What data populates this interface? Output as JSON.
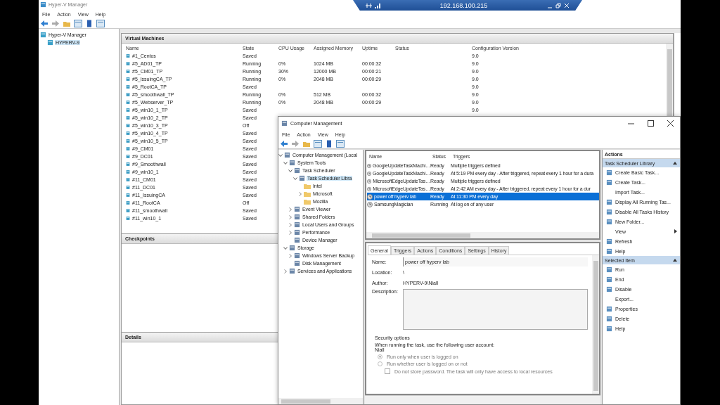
{
  "remote_bar": {
    "title": "192.168.100.215"
  },
  "hyperv": {
    "title": "Hyper-V Manager",
    "menu": [
      "File",
      "Action",
      "View",
      "Help"
    ],
    "tree": [
      {
        "label": "Hyper-V Manager",
        "selected": false
      },
      {
        "label": "HYPERV-9",
        "selected": true
      }
    ],
    "vm_panel": {
      "title": "Virtual Machines",
      "columns": [
        "Name",
        "State",
        "CPU Usage",
        "Assigned Memory",
        "Uptime",
        "Status",
        "Configuration Version"
      ],
      "rows": [
        [
          "#1_Centos",
          "Saved",
          "",
          "",
          "",
          "",
          "9.0"
        ],
        [
          "#5_AD01_TP",
          "Running",
          "0%",
          "1024 MB",
          "00:00:32",
          "",
          "9.0"
        ],
        [
          "#5_CM01_TP",
          "Running",
          "30%",
          "12000 MB",
          "00:00:21",
          "",
          "9.0"
        ],
        [
          "#5_IssuingCA_TP",
          "Running",
          "0%",
          "2048 MB",
          "00:00:29",
          "",
          "9.0"
        ],
        [
          "#5_RootCA_TP",
          "Saved",
          "",
          "",
          "",
          "",
          "9.0"
        ],
        [
          "#5_smoothwall_TP",
          "Running",
          "0%",
          "512 MB",
          "00:00:32",
          "",
          "9.0"
        ],
        [
          "#5_Webserver_TP",
          "Running",
          "0%",
          "2048 MB",
          "00:00:29",
          "",
          "9.0"
        ],
        [
          "#5_win10_1_TP",
          "Saved",
          "",
          "",
          "",
          "",
          "9.0"
        ],
        [
          "#5_win10_2_TP",
          "Saved"
        ],
        [
          "#5_win10_3_TP",
          "Off"
        ],
        [
          "#5_win10_4_TP",
          "Saved"
        ],
        [
          "#5_win10_5_TP",
          "Saved"
        ],
        [
          "#9_CM01",
          "Saved"
        ],
        [
          "#9_DC01",
          "Saved"
        ],
        [
          "#9_Smoothwall",
          "Saved"
        ],
        [
          "#9_win10_1",
          "Saved"
        ],
        [
          "#11_CM01",
          "Saved"
        ],
        [
          "#11_DC01",
          "Saved"
        ],
        [
          "#11_IssuingCA",
          "Saved"
        ],
        [
          "#11_RootCA",
          "Off"
        ],
        [
          "#11_smoothwall",
          "Saved"
        ],
        [
          "#11_win10_1",
          "Saved"
        ]
      ]
    },
    "checkpoints_title": "Checkpoints",
    "details_title": "Details"
  },
  "computer_management": {
    "title": "Computer Management",
    "menu": [
      "File",
      "Action",
      "View",
      "Help"
    ],
    "tree": [
      {
        "label": "Computer Management (Local",
        "expanded": true,
        "children": [
          {
            "label": "System Tools",
            "expanded": true,
            "children": [
              {
                "label": "Task Scheduler",
                "expanded": true,
                "children": [
                  {
                    "label": "Task Scheduler Libra",
                    "expanded": true,
                    "selected": true,
                    "children": [
                      {
                        "label": "Intel",
                        "kind": "folder"
                      },
                      {
                        "label": "Microsoft",
                        "kind": "folder",
                        "expanded": false
                      },
                      {
                        "label": "Mozilla",
                        "kind": "folder"
                      }
                    ]
                  }
                ]
              },
              {
                "label": "Event Viewer",
                "expanded": false
              },
              {
                "label": "Shared Folders",
                "expanded": false
              },
              {
                "label": "Local Users and Groups",
                "expanded": false
              },
              {
                "label": "Performance",
                "expanded": false
              },
              {
                "label": "Device Manager"
              }
            ]
          },
          {
            "label": "Storage",
            "expanded": true,
            "children": [
              {
                "label": "Windows Server Backup",
                "expanded": false
              },
              {
                "label": "Disk Management"
              }
            ]
          },
          {
            "label": "Services and Applications",
            "expanded": false
          }
        ]
      }
    ],
    "task_columns": [
      "Name",
      "Status",
      "Triggers"
    ],
    "tasks": [
      {
        "name": "GoogleUpdateTaskMachi…",
        "status": "Ready",
        "triggers": "Multiple triggers defined",
        "selected": false
      },
      {
        "name": "GoogleUpdateTaskMachi…",
        "status": "Ready",
        "triggers": "At 5:19 PM every day - After triggered, repeat every 1 hour for a dura",
        "selected": false
      },
      {
        "name": "MicrosoftEdgeUpdateTas…",
        "status": "Ready",
        "triggers": "Multiple triggers defined",
        "selected": false
      },
      {
        "name": "MicrosoftEdgeUpdateTas…",
        "status": "Ready",
        "triggers": "At 2:42 AM every day - After triggered, repeat every 1 hour for a dur",
        "selected": false
      },
      {
        "name": "power off hyperv lab",
        "status": "Ready",
        "triggers": "At 11:30 PM every day",
        "selected": true
      },
      {
        "name": "SamsungMagician",
        "status": "Running",
        "triggers": "At log on of any user",
        "selected": false
      }
    ],
    "tabs": [
      {
        "label": "General",
        "selected": true
      },
      {
        "label": "Triggers",
        "selected": false
      },
      {
        "label": "Actions",
        "selected": false
      },
      {
        "label": "Conditions",
        "selected": false
      },
      {
        "label": "Settings",
        "selected": false
      },
      {
        "label": "History",
        "selected": false
      }
    ],
    "general": {
      "name_label": "Name:",
      "name_value": "power off hyperv lab",
      "location_label": "Location:",
      "location_value": "\\",
      "author_label": "Author:",
      "author_value": "HYPERV-9\\Niall",
      "description_label": "Description:",
      "security_title": "Security options",
      "account_prompt": "When running the task, use the following user account:",
      "account": "Niall",
      "radios": [
        {
          "label": "Run only when user is logged on",
          "selected": true
        },
        {
          "label": "Run whether user is logged on or not",
          "selected": false
        }
      ],
      "checkbox": {
        "label": "Do not store password.  The task will only have access to local resources",
        "checked": false
      }
    },
    "actions_title": "Actions",
    "action_groups": [
      {
        "title": "Task Scheduler Library",
        "items": [
          {
            "label": "Create Basic Task...",
            "kind": "icon"
          },
          {
            "label": "Create Task...",
            "kind": "icon"
          },
          {
            "label": "Import Task...",
            "kind": "plain"
          },
          {
            "label": "Display All Running Tas...",
            "kind": "icon"
          },
          {
            "label": "Disable All Tasks History",
            "kind": "icon"
          },
          {
            "label": "New Folder...",
            "kind": "icon"
          },
          {
            "label": "View",
            "kind": "submenu"
          },
          {
            "label": "Refresh",
            "kind": "icon"
          },
          {
            "label": "Help",
            "kind": "icon"
          }
        ]
      },
      {
        "title": "Selected Item",
        "items": [
          {
            "label": "Run",
            "kind": "icon"
          },
          {
            "label": "End",
            "kind": "icon"
          },
          {
            "label": "Disable",
            "kind": "icon"
          },
          {
            "label": "Export...",
            "kind": "plain"
          },
          {
            "label": "Properties",
            "kind": "icon"
          },
          {
            "label": "Delete",
            "kind": "icon"
          },
          {
            "label": "Help",
            "kind": "icon"
          }
        ]
      }
    ]
  }
}
